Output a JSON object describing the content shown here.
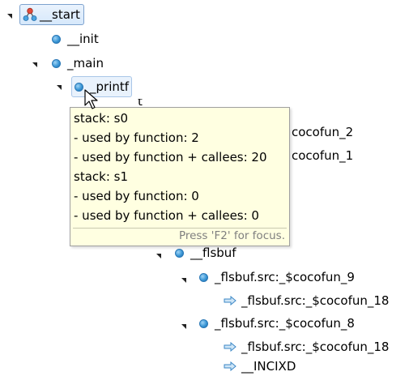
{
  "tree": {
    "start_label": "__start",
    "init_label": "__init",
    "main_label": "_main",
    "printf_label": "_printf",
    "partial_label": "t",
    "cocofun2_label": "cocofun_2",
    "cocofun1_label": "cocofun_1",
    "flsbuf_label": "__flsbuf",
    "flsbuf9_label": "_flsbuf.src:_$cocofun_9",
    "flsbuf18a_label": "_flsbuf.src:_$cocofun_18",
    "flsbuf8_label": "_flsbuf.src:_$cocofun_8",
    "flsbuf18b_label": "_flsbuf.src:_$cocofun_18",
    "incixd_label": "__INCIXD"
  },
  "tooltip": {
    "lines": [
      "stack: s0",
      "- used by function: 2",
      "- used by function + callees: 20",
      "stack: s1",
      "- used by function: 0",
      "- used by function + callees: 0"
    ],
    "hint": "Press 'F2' for focus."
  },
  "colors": {
    "accent": "#3b97d6",
    "tooltip_bg": "#ffffe1",
    "selection": "#d6e8fb"
  },
  "icons": [
    "root-node-icon",
    "function-node-icon",
    "reference-arrow-icon",
    "expand-toggle-icon"
  ]
}
